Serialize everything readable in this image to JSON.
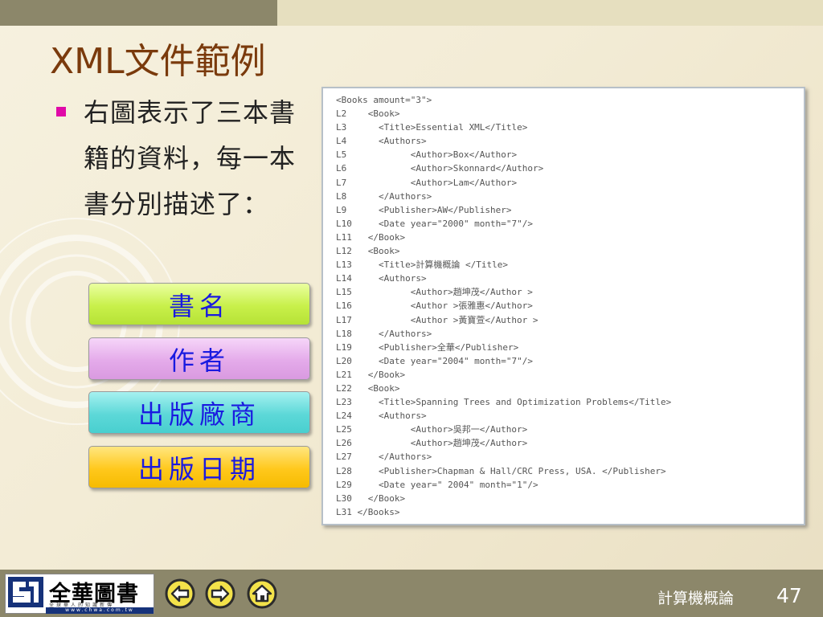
{
  "slide": {
    "title": "XML文件範例",
    "bullet": "右圖表示了三本書籍的資料，每一本書分別描述了："
  },
  "legend": [
    {
      "label": "書名",
      "color": "#c8f04a"
    },
    {
      "label": "作者",
      "color": "#e4aaea"
    },
    {
      "label": "出版廠商",
      "color": "#5cd8d8"
    },
    {
      "label": "出版日期",
      "color": "#ffc81c"
    }
  ],
  "code": {
    "lines": [
      "<Books amount=\"3\">",
      "L2    <Book>",
      "L3      <Title>Essential XML</Title>",
      "L4      <Authors>",
      "L5            <Author>Box</Author>",
      "L6            <Author>Skonnard</Author>",
      "L7            <Author>Lam</Author>",
      "L8      </Authors>",
      "L9      <Publisher>AW</Publisher>",
      "L10     <Date year=\"2000\" month=\"7\"/>",
      "L11   </Book>",
      "L12   <Book>",
      "L13     <Title>計算機概論 </Title>",
      "L14     <Authors>",
      "L15           <Author>趙坤茂</Author >",
      "L16           <Author >張雅惠</Author>",
      "L17           <Author >黃寶萱</Author >",
      "L18     </Authors>",
      "L19     <Publisher>全華</Publisher>",
      "L20     <Date year=\"2004\" month=\"7\"/>",
      "L21   </Book>",
      "L22   <Book>",
      "L23     <Title>Spanning Trees and Optimization Problems</Title>",
      "L24     <Authors>",
      "L25           <Author>吳邦一</Author>",
      "L26           <Author>趙坤茂</Author>",
      "L27     </Authors>",
      "L28     <Publisher>Chapman & Hall/CRC Press, USA. </Publisher>",
      "L29     <Date year=\" 2004\" month=\"1\"/>",
      "L30   </Book>",
      "L31 </Books>"
    ]
  },
  "footer": {
    "logo_text": "全華圖書",
    "logo_sub": "全球華人的知識新傳",
    "logo_url": "www.chwa.com.tw",
    "course": "計算機概論",
    "page": "47"
  },
  "colors": {
    "title": "#7a3a0c",
    "bullet": "#e00aa8",
    "legend_text": "#1a1ae0",
    "bar": "#8c876a",
    "nav": "#f3e24a"
  },
  "icons": {
    "prev": "arrow-left-circle-icon",
    "next": "arrow-right-circle-icon",
    "home": "home-circle-icon"
  }
}
